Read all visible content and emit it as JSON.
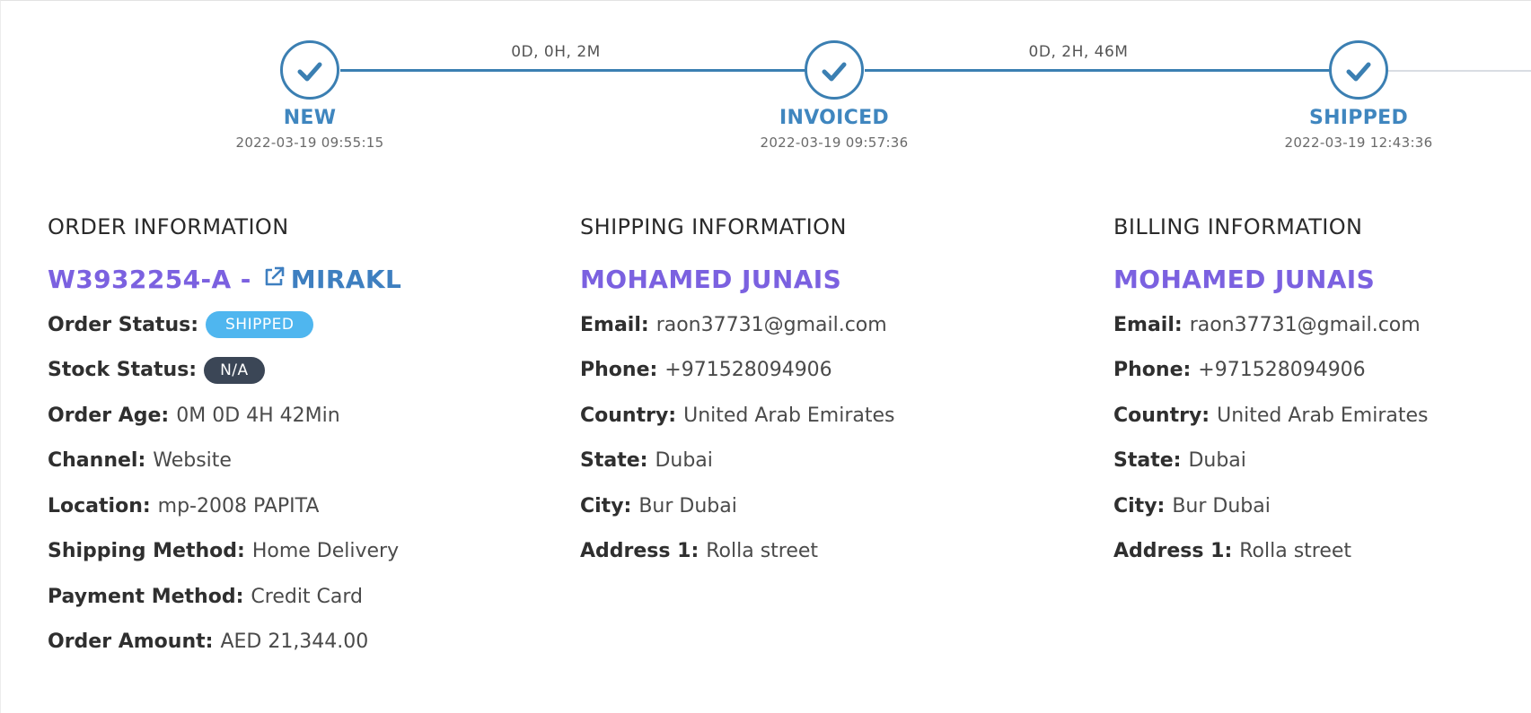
{
  "timeline": {
    "steps": [
      {
        "label": "NEW",
        "date": "2022-03-19 09:55:15"
      },
      {
        "label": "INVOICED",
        "date": "2022-03-19 09:57:36"
      },
      {
        "label": "SHIPPED",
        "date": "2022-03-19 12:43:36"
      }
    ],
    "durations": [
      "0D, 0H, 2M",
      "0D, 2H, 46M"
    ]
  },
  "order": {
    "heading": "ORDER INFORMATION",
    "order_id": "W3932254-A -",
    "channel_link": "MIRAKL",
    "status_label": "Order Status:",
    "status_value": "SHIPPED",
    "stock_label": "Stock Status:",
    "stock_value": "N/A",
    "age_label": "Order Age:",
    "age_value": "0M 0D 4H 42Min",
    "channel_label": "Channel:",
    "channel_value": "Website",
    "location_label": "Location:",
    "location_value": "mp-2008 PAPITA",
    "shipping_method_label": "Shipping Method:",
    "shipping_method_value": "Home Delivery",
    "payment_method_label": "Payment Method:",
    "payment_method_value": "Credit Card",
    "amount_label": "Order Amount:",
    "amount_value": "AED 21,344.00"
  },
  "shipping": {
    "heading": "SHIPPING INFORMATION",
    "name": "MOHAMED JUNAIS",
    "email_label": "Email:",
    "email_value": "raon37731@gmail.com",
    "phone_label": "Phone:",
    "phone_value": "+971528094906",
    "country_label": "Country:",
    "country_value": "United Arab Emirates",
    "state_label": "State:",
    "state_value": "Dubai",
    "city_label": "City:",
    "city_value": "Bur Dubai",
    "address_label": "Address 1:",
    "address_value": "Rolla street"
  },
  "billing": {
    "heading": "BILLING INFORMATION",
    "name": "MOHAMED JUNAIS",
    "email_label": "Email:",
    "email_value": "raon37731@gmail.com",
    "phone_label": "Phone:",
    "phone_value": "+971528094906",
    "country_label": "Country:",
    "country_value": "United Arab Emirates",
    "state_label": "State:",
    "state_value": "Dubai",
    "city_label": "City:",
    "city_value": "Bur Dubai",
    "address_label": "Address 1:",
    "address_value": "Rolla street"
  },
  "colors": {
    "accent_blue": "#3b7fb2",
    "name_purple": "#7b61e0",
    "badge_shipped": "#4fb6ef",
    "badge_na": "#3b4656"
  },
  "icons": {
    "step": "check-icon",
    "external": "external-link-icon"
  }
}
